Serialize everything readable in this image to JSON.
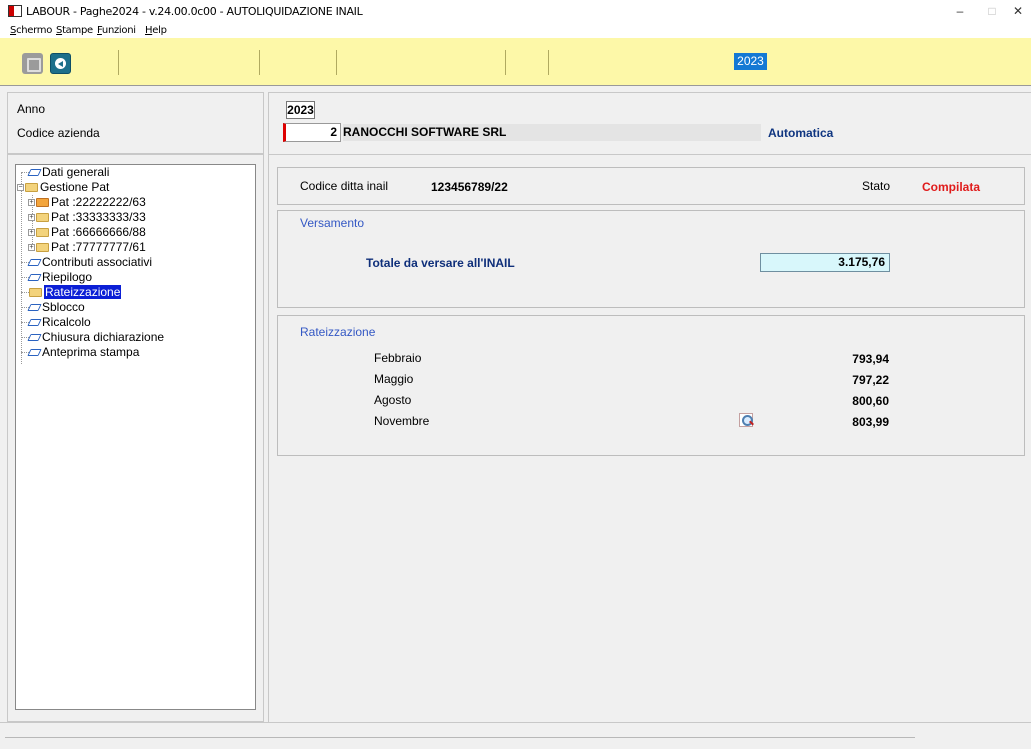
{
  "window": {
    "title": "LABOUR - Paghe2024 - v.24.00.0c00 - AUTOLIQUIDAZIONE INAIL",
    "minimize": "–",
    "maximize": "□",
    "close": "✕"
  },
  "menu": [
    "Schermo",
    "Stampe",
    "Funzioni",
    "Help"
  ],
  "toolbar": {
    "year_badge": "2023",
    "icons": [
      "page-icon",
      "back-arrow-icon"
    ]
  },
  "header": {
    "anno_label": "Anno",
    "codice_label": "Codice azienda",
    "anno_value": "2023",
    "codice_value": "2",
    "azienda_name": "RANOCCHI SOFTWARE SRL",
    "mode": "Automatica"
  },
  "tree": [
    {
      "label": "Dati generali",
      "icon": "doc-icon"
    },
    {
      "label": "Gestione Pat",
      "icon": "folder-icon"
    },
    {
      "label": "Pat :22222222/63",
      "icon": "folder-check-icon"
    },
    {
      "label": "Pat :33333333/33",
      "icon": "folder-icon"
    },
    {
      "label": "Pat :66666666/88",
      "icon": "folder-icon"
    },
    {
      "label": "Pat :77777777/61",
      "icon": "folder-icon"
    },
    {
      "label": "Contributi associativi",
      "icon": "doc-icon"
    },
    {
      "label": "Riepilogo",
      "icon": "doc-icon"
    },
    {
      "label": "Rateizzazione",
      "icon": "folder-icon",
      "selected": true
    },
    {
      "label": "Sblocco",
      "icon": "doc-icon"
    },
    {
      "label": "Ricalcolo",
      "icon": "doc-icon"
    },
    {
      "label": "Chiusura dichiarazione",
      "icon": "doc-icon"
    },
    {
      "label": "Anteprima stampa",
      "icon": "doc-icon"
    }
  ],
  "info": {
    "codice_ditta_label": "Codice ditta inail",
    "codice_ditta_value": "123456789/22",
    "stato_label": "Stato",
    "stato_value": "Compilata",
    "stato_color": "#e01b1b"
  },
  "versamento": {
    "title": "Versamento",
    "totale_label": "Totale da versare all'INAIL",
    "totale_value": "3.175,76"
  },
  "rateizzazione": {
    "title": "Rateizzazione",
    "rows": [
      {
        "month": "Febbraio",
        "amount": "793,94"
      },
      {
        "month": "Maggio",
        "amount": "797,22"
      },
      {
        "month": "Agosto",
        "amount": "800,60"
      },
      {
        "month": "Novembre",
        "amount": "803,99"
      }
    ]
  }
}
